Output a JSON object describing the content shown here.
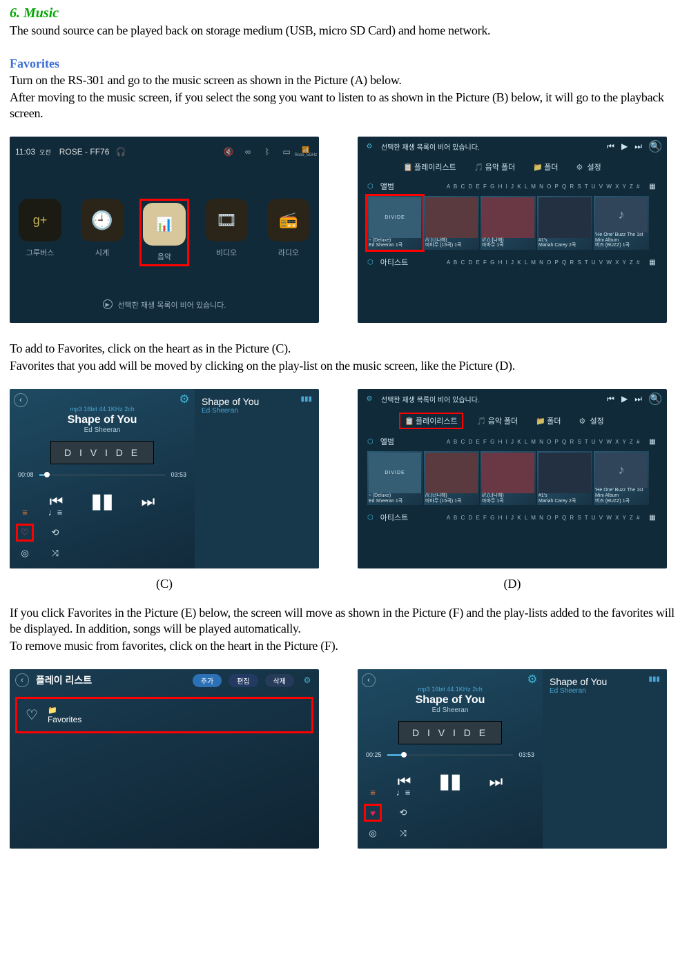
{
  "sectionTitle": "6. Music",
  "intro": "The sound source can be played back on storage medium (USB, micro SD Card) and home network.",
  "subTitle1": "Favorites",
  "para1a": "Turn on the RS-301 and go to the music screen as shown in the Picture (A) below.",
  "para1b": "After moving to the music screen, if you select the song you want to listen to as shown in the Picture (B) below, it will go to the playback screen.",
  "para2a": "To add to Favorites, click on the heart as in the Picture (C).",
  "para2b": "Favorites that you add will be moved by clicking on the play-list on the music screen, like the Picture (D).",
  "captionC": "(C)",
  "captionD": "(D)",
  "para3a": "If you click Favorites in the Picture (E) below, the screen will move as shown in the Picture (F) and the play-lists added to the favorites will be displayed. In addition, songs will be played automatically.",
  "para3b": "To remove music from favorites, click on the heart in the Picture (F).",
  "figA": {
    "time": "11:03",
    "ampm": "오전",
    "device": "ROSE - FF76",
    "wifi": "Rose_5GHz",
    "tiles": [
      "그루버스",
      "시계",
      "음악",
      "비디오",
      "라디오"
    ],
    "bottom": "선택한 재생 목록이 비어 있습니다."
  },
  "figB": {
    "msg": "선택한 재생 목록이 비어 있습니다.",
    "tabs": [
      "플레이리스트",
      "음악 폴더",
      "폴더",
      "설정"
    ],
    "sec1": "앨범",
    "sec2": "아티스트",
    "alpha": "A B C D E F G H I J K L M N O P Q R S T U V W X Y Z #",
    "albums": [
      {
        "t1": "÷ (Deluxe)",
        "t2": "Ed Sheeran 1곡"
      },
      {
        "t1": "///.(너나해)",
        "t2": "마마무 (15곡) 1곡"
      },
      {
        "t1": "///.(너나해)",
        "t2": "마마무 1곡"
      },
      {
        "t1": "#1's",
        "t2": "Mariah Carey 2곡"
      },
      {
        "t1": "'He One'  Buzz The 1st Mini Album",
        "t2": "버즈 (BUZZ) 1곡"
      }
    ]
  },
  "figC": {
    "fmt": "mp3 16bit 44.1KHz 2ch",
    "song": "Shape of You",
    "artist": "Ed Sheeran",
    "album": "D I V I D E",
    "t1": "00:08",
    "t2": "03:53"
  },
  "figE": {
    "title": "플레이 리스트",
    "b1": "추가",
    "b2": "편집",
    "b3": "삭제",
    "fav": "Favorites"
  },
  "figF": {
    "fmt": "mp3 16bit 44.1KHz 2ch",
    "song": "Shape of You",
    "artist": "Ed Sheeran",
    "album": "D I V I D E",
    "t1": "00:25",
    "t2": "03:53"
  }
}
